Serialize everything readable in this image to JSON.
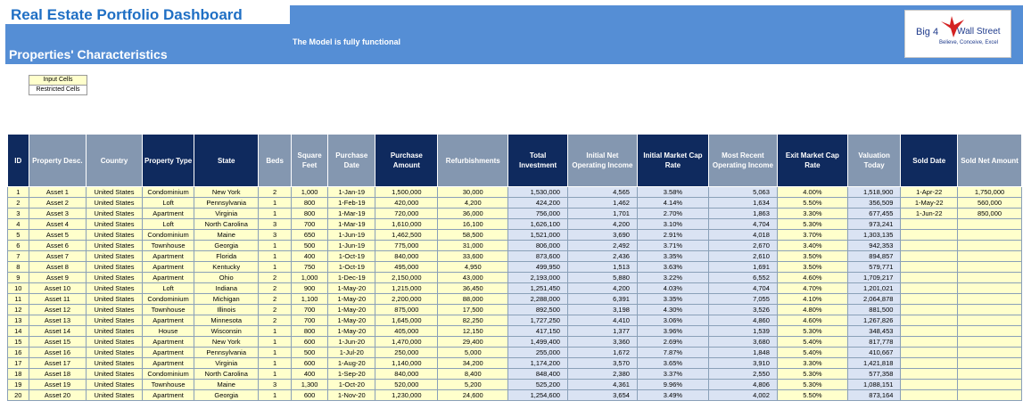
{
  "header": {
    "title": "Real Estate Portfolio Dashboard",
    "subtitle": "Properties' Characteristics",
    "model_note": "The Model is fully functional",
    "logo_big4": "Big 4",
    "logo_name": "Wall Street",
    "logo_tagline": "Believe, Conceive, Excel"
  },
  "legend": {
    "input": "Input Cells",
    "restricted": "Restricted Cells"
  },
  "colors": {
    "banner": "#558ed5",
    "header_dark": "#0f2a5e",
    "header_light": "#8497b0",
    "input_fill": "#ffffcc",
    "calc_fill": "#dae3f3"
  },
  "table": {
    "columns": [
      "ID",
      "Property Desc.",
      "Country",
      "Property Type",
      "State",
      "Beds",
      "Square Feet",
      "Purchase Date",
      "Purchase Amount",
      "Refurbishments",
      "Total Investment",
      "Initial Net Operating Income",
      "Initial Market Cap Rate",
      "Most Recent Operating Income",
      "Exit Market Cap Rate",
      "Valuation Today",
      "Sold Date",
      "Sold Net Amount"
    ],
    "rows": [
      [
        "1",
        "Asset 1",
        "United States",
        "Condominium",
        "New York",
        "2",
        "1,000",
        "1-Jan-19",
        "1,500,000",
        "30,000",
        "1,530,000",
        "4,565",
        "3.58%",
        "5,063",
        "4.00%",
        "1,518,900",
        "1-Apr-22",
        "1,750,000"
      ],
      [
        "2",
        "Asset 2",
        "United States",
        "Loft",
        "Pennsylvania",
        "1",
        "800",
        "1-Feb-19",
        "420,000",
        "4,200",
        "424,200",
        "1,462",
        "4.14%",
        "1,634",
        "5.50%",
        "356,509",
        "1-May-22",
        "560,000"
      ],
      [
        "3",
        "Asset 3",
        "United States",
        "Apartment",
        "Virginia",
        "1",
        "800",
        "1-Mar-19",
        "720,000",
        "36,000",
        "756,000",
        "1,701",
        "2.70%",
        "1,863",
        "3.30%",
        "677,455",
        "1-Jun-22",
        "850,000"
      ],
      [
        "4",
        "Asset 4",
        "United States",
        "Loft",
        "North Carolina",
        "3",
        "700",
        "1-Mar-19",
        "1,610,000",
        "16,100",
        "1,626,100",
        "4,200",
        "3.10%",
        "4,704",
        "5.30%",
        "973,241",
        "",
        ""
      ],
      [
        "5",
        "Asset 5",
        "United States",
        "Condominium",
        "Maine",
        "3",
        "650",
        "1-Jun-19",
        "1,462,500",
        "58,500",
        "1,521,000",
        "3,690",
        "2.91%",
        "4,018",
        "3.70%",
        "1,303,135",
        "",
        ""
      ],
      [
        "6",
        "Asset 6",
        "United States",
        "Townhouse",
        "Georgia",
        "1",
        "500",
        "1-Jun-19",
        "775,000",
        "31,000",
        "806,000",
        "2,492",
        "3.71%",
        "2,670",
        "3.40%",
        "942,353",
        "",
        ""
      ],
      [
        "7",
        "Asset 7",
        "United States",
        "Apartment",
        "Florida",
        "1",
        "400",
        "1-Oct-19",
        "840,000",
        "33,600",
        "873,600",
        "2,436",
        "3.35%",
        "2,610",
        "3.50%",
        "894,857",
        "",
        ""
      ],
      [
        "8",
        "Asset 8",
        "United States",
        "Apartment",
        "Kentucky",
        "1",
        "750",
        "1-Oct-19",
        "495,000",
        "4,950",
        "499,950",
        "1,513",
        "3.63%",
        "1,691",
        "3.50%",
        "579,771",
        "",
        ""
      ],
      [
        "9",
        "Asset 9",
        "United States",
        "Apartment",
        "Ohio",
        "2",
        "1,000",
        "1-Dec-19",
        "2,150,000",
        "43,000",
        "2,193,000",
        "5,880",
        "3.22%",
        "6,552",
        "4.60%",
        "1,709,217",
        "",
        ""
      ],
      [
        "10",
        "Asset 10",
        "United States",
        "Loft",
        "Indiana",
        "2",
        "900",
        "1-May-20",
        "1,215,000",
        "36,450",
        "1,251,450",
        "4,200",
        "4.03%",
        "4,704",
        "4.70%",
        "1,201,021",
        "",
        ""
      ],
      [
        "11",
        "Asset 11",
        "United States",
        "Condominium",
        "Michigan",
        "2",
        "1,100",
        "1-May-20",
        "2,200,000",
        "88,000",
        "2,288,000",
        "6,391",
        "3.35%",
        "7,055",
        "4.10%",
        "2,064,878",
        "",
        ""
      ],
      [
        "12",
        "Asset 12",
        "United States",
        "Townhouse",
        "Illinois",
        "2",
        "700",
        "1-May-20",
        "875,000",
        "17,500",
        "892,500",
        "3,198",
        "4.30%",
        "3,526",
        "4.80%",
        "881,500",
        "",
        ""
      ],
      [
        "13",
        "Asset 13",
        "United States",
        "Apartment",
        "Minnesota",
        "2",
        "700",
        "1-May-20",
        "1,645,000",
        "82,250",
        "1,727,250",
        "4,410",
        "3.06%",
        "4,860",
        "4.60%",
        "1,267,826",
        "",
        ""
      ],
      [
        "14",
        "Asset 14",
        "United States",
        "House",
        "Wisconsin",
        "1",
        "800",
        "1-May-20",
        "405,000",
        "12,150",
        "417,150",
        "1,377",
        "3.96%",
        "1,539",
        "5.30%",
        "348,453",
        "",
        ""
      ],
      [
        "15",
        "Asset 15",
        "United States",
        "Apartment",
        "New York",
        "1",
        "600",
        "1-Jun-20",
        "1,470,000",
        "29,400",
        "1,499,400",
        "3,360",
        "2.69%",
        "3,680",
        "5.40%",
        "817,778",
        "",
        ""
      ],
      [
        "16",
        "Asset 16",
        "United States",
        "Apartment",
        "Pennsylvania",
        "1",
        "500",
        "1-Jul-20",
        "250,000",
        "5,000",
        "255,000",
        "1,672",
        "7.87%",
        "1,848",
        "5.40%",
        "410,667",
        "",
        ""
      ],
      [
        "17",
        "Asset 17",
        "United States",
        "Apartment",
        "Virginia",
        "1",
        "600",
        "1-Aug-20",
        "1,140,000",
        "34,200",
        "1,174,200",
        "3,570",
        "3.65%",
        "3,910",
        "3.30%",
        "1,421,818",
        "",
        ""
      ],
      [
        "18",
        "Asset 18",
        "United States",
        "Condominium",
        "North Carolina",
        "1",
        "400",
        "1-Sep-20",
        "840,000",
        "8,400",
        "848,400",
        "2,380",
        "3.37%",
        "2,550",
        "5.30%",
        "577,358",
        "",
        ""
      ],
      [
        "19",
        "Asset 19",
        "United States",
        "Townhouse",
        "Maine",
        "3",
        "1,300",
        "1-Oct-20",
        "520,000",
        "5,200",
        "525,200",
        "4,361",
        "9.96%",
        "4,806",
        "5.30%",
        "1,088,151",
        "",
        ""
      ],
      [
        "20",
        "Asset 20",
        "United States",
        "Apartment",
        "Georgia",
        "1",
        "600",
        "1-Nov-20",
        "1,230,000",
        "24,600",
        "1,254,600",
        "3,654",
        "3.49%",
        "4,002",
        "5.50%",
        "873,164",
        "",
        ""
      ]
    ]
  }
}
